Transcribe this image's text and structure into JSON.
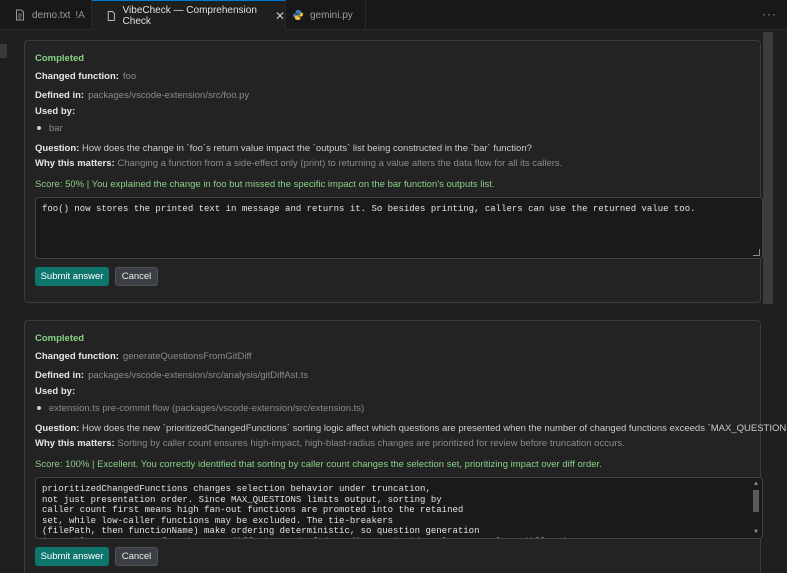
{
  "tabs": [
    {
      "label": "demo.txt",
      "modifier": "!A",
      "icon": "file-text-icon"
    },
    {
      "label": "VibeCheck — Comprehension Check",
      "icon": "preview-file-icon",
      "close": "✕"
    },
    {
      "label": "gemini.py",
      "icon": "python-icon"
    }
  ],
  "more_actions": "···",
  "cards": [
    {
      "status": "Completed",
      "changed_function_label": "Changed function:",
      "changed_function": "foo",
      "defined_in_label": "Defined in:",
      "defined_in": "packages/vscode-extension/src/foo.py",
      "used_by_label": "Used by:",
      "used_by": [
        "bar"
      ],
      "question_label": "Question:",
      "question": "How does the change in `foo`s return value impact the `outputs` list being constructed in the `bar` function?",
      "why_label": "Why this matters:",
      "why": "Changing a function from a side-effect only (print) to returning a value alters the data flow for all its callers.",
      "score": "Score: 50% | You explained the change in foo but missed the specific impact on the bar function's outputs list.",
      "answer": "foo() now stores the printed text in message and returns it. So besides printing, callers can use the returned value too.",
      "submit_label": "Submit answer",
      "cancel_label": "Cancel"
    },
    {
      "status": "Completed",
      "changed_function_label": "Changed function:",
      "changed_function": "generateQuestionsFromGitDiff",
      "defined_in_label": "Defined in:",
      "defined_in": "packages/vscode-extension/src/analysis/gitDiffAst.ts",
      "used_by_label": "Used by:",
      "used_by": [
        "extension.ts pre-commit flow (packages/vscode-extension/src/extension.ts)"
      ],
      "question_label": "Question:",
      "question": "How does the new `prioritizedChangedFunctions` sorting logic affect which questions are presented when the number of changed functions exceeds `MAX_QUESTIONS`?",
      "why_label": "Why this matters:",
      "why": "Sorting by caller count ensures high-impact, high-blast-radius changes are prioritized for review before truncation occurs.",
      "score": "Score: 100% | Excellent. You correctly identified that sorting by caller count changes the selection set, prioritizing impact over diff order.",
      "answer": "prioritizedChangedFunctions changes selection behavior under truncation,\nnot just presentation order. Since MAX_QUESTIONS limits output, sorting by\ncaller count first means high fan-out functions are promoted into the retained\nset, while low-caller functions may be excluded. The tie-breakers\n(filePath, then functionName) make ordering deterministic, so question generation\nis stable across runs for the same diff, instead of depending on incidental traversal or diff order.",
      "submit_label": "Submit answer",
      "cancel_label": "Cancel"
    }
  ],
  "colors": {
    "status": "#89d185",
    "primary_button": "#0f766e",
    "background": "#1f1f1f"
  }
}
